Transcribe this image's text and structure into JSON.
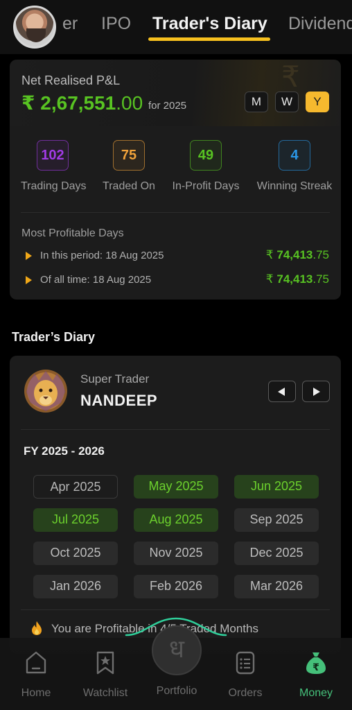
{
  "top_tabs": {
    "items": [
      "er",
      "IPO",
      "Trader's Diary",
      "Dividend"
    ],
    "active": "Trader's Diary"
  },
  "pnl": {
    "label": "Net Realised P&L",
    "currency": "₹",
    "value_main": "2,67,551",
    "value_decimal": ".00",
    "period_text": "for 2025",
    "periods": [
      "M",
      "W",
      "Y"
    ],
    "selected_period": "Y",
    "watermark": "₹"
  },
  "stats": [
    {
      "value": "102",
      "label": "Trading Days",
      "color": "#a23be6"
    },
    {
      "value": "75",
      "label": "Traded On",
      "color": "#f0a23a"
    },
    {
      "value": "49",
      "label": "In-Profit Days",
      "color": "#58c322"
    },
    {
      "value": "4",
      "label": "Winning Streak",
      "color": "#2a97e8"
    }
  ],
  "most_profitable": {
    "title": "Most Profitable Days",
    "rows": [
      {
        "text": "In this period: 18 Aug 2025",
        "currency": "₹",
        "amount_main": "74,413",
        "amount_decimal": ".75"
      },
      {
        "text": "Of all time: 18 Aug 2025",
        "currency": "₹",
        "amount_main": "74,413",
        "amount_decimal": ".75"
      }
    ]
  },
  "diary": {
    "section_title": "Trader’s Diary",
    "trader_kind": "Super Trader",
    "trader_name": "NANDEEP",
    "fy_label": "FY 2025 - 2026",
    "months": [
      {
        "label": "Apr 2025",
        "status": "none"
      },
      {
        "label": "May 2025",
        "status": "profit"
      },
      {
        "label": "Jun 2025",
        "status": "profit"
      },
      {
        "label": "Jul 2025",
        "status": "profit"
      },
      {
        "label": "Aug 2025",
        "status": "profit"
      },
      {
        "label": "Sep 2025",
        "status": "empty"
      },
      {
        "label": "Oct 2025",
        "status": "empty"
      },
      {
        "label": "Nov 2025",
        "status": "empty"
      },
      {
        "label": "Dec 2025",
        "status": "empty"
      },
      {
        "label": "Jan 2026",
        "status": "empty"
      },
      {
        "label": "Feb 2026",
        "status": "empty"
      },
      {
        "label": "Mar 2026",
        "status": "empty"
      }
    ],
    "profit_note": "You are Profitable in 4/5 Traded Months"
  },
  "bottom_nav": {
    "items": [
      {
        "label": "Home",
        "icon": "home-icon"
      },
      {
        "label": "Watchlist",
        "icon": "bookmark-star-icon"
      },
      {
        "label": "Portfolio",
        "icon": "portfolio-logo-icon"
      },
      {
        "label": "Orders",
        "icon": "orders-icon"
      },
      {
        "label": "Money",
        "icon": "money-bag-icon"
      }
    ],
    "active": "Money",
    "fab_glyph": "ध"
  },
  "colors": {
    "accent_yellow": "#f6c01e",
    "profit_green": "#58c322",
    "money_green": "#45c07a"
  }
}
